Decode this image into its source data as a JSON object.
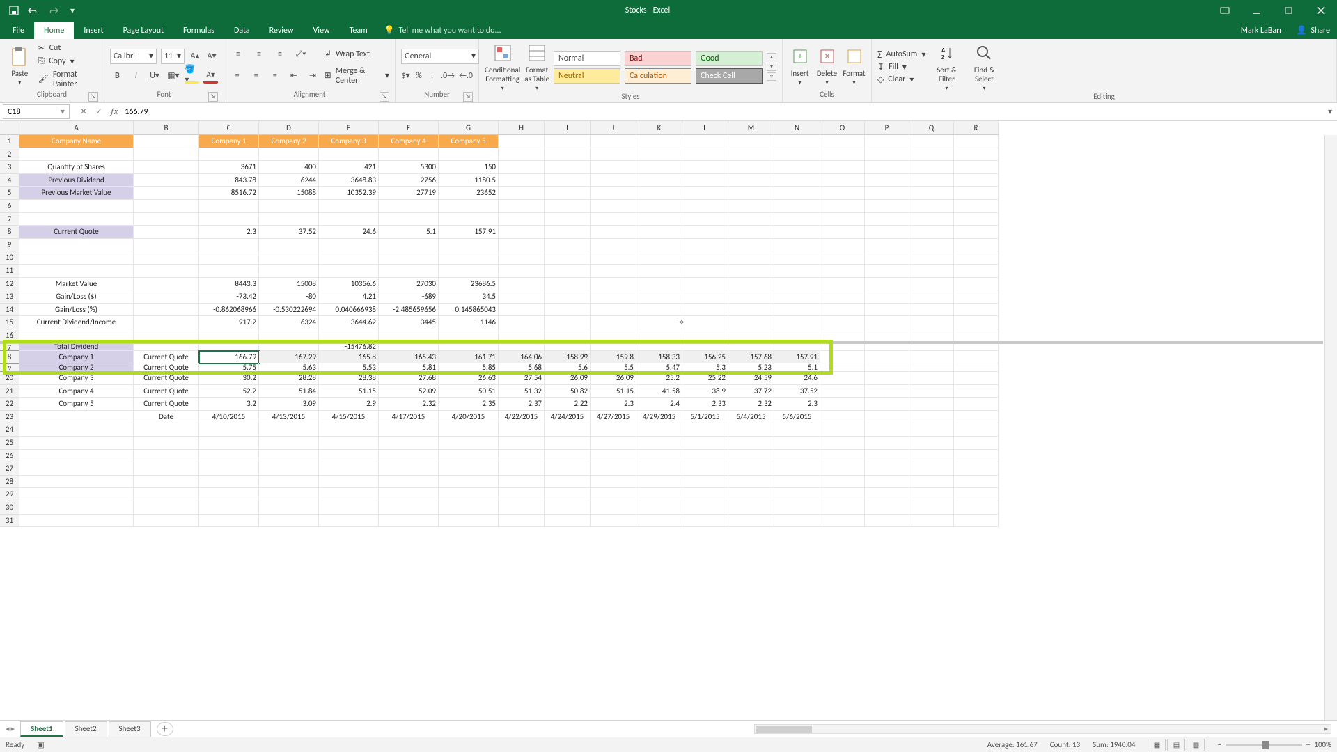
{
  "app_title": "Stocks - Excel",
  "user_name": "Mark LaBarr",
  "share_label": "Share",
  "tell_me_placeholder": "Tell me what you want to do...",
  "tabs": [
    "File",
    "Home",
    "Insert",
    "Page Layout",
    "Formulas",
    "Data",
    "Review",
    "View",
    "Team"
  ],
  "active_tab": "Home",
  "ribbon": {
    "clipboard": {
      "label": "Clipboard",
      "paste": "Paste",
      "cut": "Cut",
      "copy": "Copy",
      "fp": "Format Painter"
    },
    "font": {
      "label": "Font",
      "font_name": "Calibri",
      "font_size": "11"
    },
    "alignment": {
      "label": "Alignment",
      "wrap": "Wrap Text",
      "merge": "Merge & Center"
    },
    "number": {
      "label": "Number",
      "format": "General"
    },
    "styles": {
      "label": "Styles",
      "cond": "Conditional Formatting",
      "table": "Format as Table",
      "s1": "Normal",
      "s2": "Bad",
      "s3": "Good",
      "s4": "Neutral",
      "s5": "Calculation",
      "s6": "Check Cell"
    },
    "cells": {
      "label": "Cells",
      "insert": "Insert",
      "delete": "Delete",
      "format": "Format"
    },
    "editing": {
      "label": "Editing",
      "sum": "AutoSum",
      "fill": "Fill",
      "clear": "Clear",
      "sort": "Sort & Filter",
      "find": "Find & Select"
    }
  },
  "namebox": "C18",
  "formula": "166.79",
  "columns": [
    "A",
    "B",
    "C",
    "D",
    "E",
    "F",
    "G",
    "H",
    "I",
    "J",
    "K",
    "L",
    "M",
    "N",
    "O",
    "P",
    "Q",
    "R"
  ],
  "col_widths": {
    "A": 164,
    "B": 94,
    "C": 86,
    "D": 86,
    "E": 86,
    "F": 86,
    "G": 86,
    "H": 66,
    "I": 66,
    "J": 66,
    "K": 66,
    "L": 66,
    "M": 66,
    "N": 66,
    "O": 64,
    "P": 64,
    "Q": 64,
    "R": 64
  },
  "top_rows": [
    "1",
    "2",
    "3",
    "4",
    "5",
    "6",
    "7",
    "8",
    "9",
    "10",
    "11",
    "12",
    "13",
    "14",
    "15",
    "16"
  ],
  "bot_rows": [
    "7",
    "8",
    "9",
    "20",
    "21",
    "22",
    "23",
    "24",
    "25",
    "26",
    "27",
    "28",
    "29",
    "30",
    "31"
  ],
  "grid_top": {
    "1": {
      "A": "Company Name",
      "C": "Company 1",
      "D": "Company 2",
      "E": "Company 3",
      "F": "Company 4",
      "G": "Company 5",
      "style": "orange"
    },
    "3": {
      "A": "Quantity of Shares",
      "C": "3671",
      "D": "400",
      "E": "421",
      "F": "5300",
      "G": "150"
    },
    "4": {
      "A": "Previous Dividend",
      "C": "-843.78",
      "D": "-6244",
      "E": "-3648.83",
      "F": "-2756",
      "G": "-1180.5",
      "astyle": "lav"
    },
    "5": {
      "A": "Previous Market Value",
      "C": "8516.72",
      "D": "15088",
      "E": "10352.39",
      "F": "27719",
      "G": "23652",
      "astyle": "lav"
    },
    "8": {
      "A": "Current Quote",
      "C": "2.3",
      "D": "37.52",
      "E": "24.6",
      "F": "5.1",
      "G": "157.91",
      "astyle": "lav"
    },
    "12": {
      "A": "Market Value",
      "C": "8443.3",
      "D": "15008",
      "E": "10356.6",
      "F": "27030",
      "G": "23686.5"
    },
    "13": {
      "A": "Gain/Loss ($)",
      "C": "-73.42",
      "D": "-80",
      "E": "4.21",
      "F": "-689",
      "G": "34.5"
    },
    "14": {
      "A": "Gain/Loss (%)",
      "C": "-0.862068966",
      "D": "-0.530222694",
      "E": "0.040666938",
      "F": "-2.485659656",
      "G": "0.145865043"
    },
    "15": {
      "A": "Current Dividend/Income",
      "C": "-917.2",
      "D": "-6324",
      "E": "-3644.62",
      "F": "-3445",
      "G": "-1146"
    }
  },
  "grid_bot": {
    "7": {
      "A": "Total Dividend",
      "E": "-15476.82",
      "split": true,
      "astyle": "lav"
    },
    "8": {
      "A": "Company 1",
      "B": "Current Quote",
      "C": "166.79",
      "D": "167.29",
      "E": "165.8",
      "F": "165.43",
      "G": "161.71",
      "H": "164.06",
      "I": "158.99",
      "J": "159.8",
      "K": "158.33",
      "L": "156.25",
      "M": "157.68",
      "N": "157.91",
      "astyle": "lav",
      "sel": true
    },
    "9": {
      "A": "Company 2",
      "B": "Current Quote",
      "C": "5.75",
      "D": "5.63",
      "E": "5.53",
      "F": "5.81",
      "G": "5.85",
      "H": "5.68",
      "I": "5.6",
      "J": "5.5",
      "K": "5.47",
      "L": "5.3",
      "M": "5.23",
      "N": "5.1",
      "split": true,
      "astyle": "lav"
    },
    "20": {
      "A": "Company 3",
      "B": "Current Quote",
      "C": "30.2",
      "D": "28.28",
      "E": "28.38",
      "F": "27.68",
      "G": "26.63",
      "H": "27.54",
      "I": "26.09",
      "J": "26.09",
      "K": "25.2",
      "L": "25.22",
      "M": "24.59",
      "N": "24.6"
    },
    "21": {
      "A": "Company 4",
      "B": "Current Quote",
      "C": "52.2",
      "D": "51.84",
      "E": "51.15",
      "F": "52.09",
      "G": "50.51",
      "H": "51.32",
      "I": "50.82",
      "J": "51.15",
      "K": "41.58",
      "L": "38.9",
      "M": "37.72",
      "N": "37.52"
    },
    "22": {
      "A": "Company 5",
      "B": "Current Quote",
      "C": "3.2",
      "D": "3.09",
      "E": "2.9",
      "F": "2.32",
      "G": "2.35",
      "H": "2.37",
      "I": "2.22",
      "J": "2.3",
      "K": "2.4",
      "L": "2.33",
      "M": "2.32",
      "N": "2.3"
    },
    "23": {
      "B": "Date",
      "C": "4/10/2015",
      "D": "4/13/2015",
      "E": "4/15/2015",
      "F": "4/17/2015",
      "G": "4/20/2015",
      "H": "4/22/2015",
      "I": "4/24/2015",
      "J": "4/27/2015",
      "K": "4/29/2015",
      "L": "5/1/2015",
      "M": "5/4/2015",
      "N": "5/6/2015"
    }
  },
  "sheets": [
    "Sheet1",
    "Sheet2",
    "Sheet3"
  ],
  "active_sheet": "Sheet1",
  "status": {
    "ready": "Ready",
    "avg": "Average: 161.67",
    "count": "Count: 13",
    "sum": "Sum: 1940.04",
    "zoom": "100%"
  }
}
